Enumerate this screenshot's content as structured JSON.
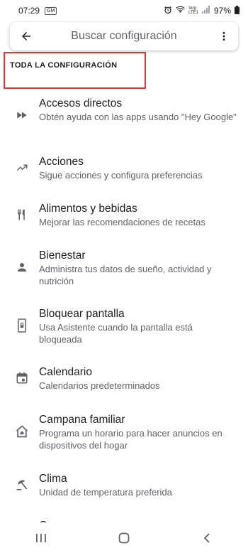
{
  "status_bar": {
    "time": "07:29",
    "badge": "GM",
    "volte_top": "Vo))",
    "volte_bottom": "LTE1",
    "battery": "97%"
  },
  "search": {
    "placeholder": "Buscar configuración"
  },
  "section": {
    "title": "TODA LA CONFIGURACIÓN"
  },
  "items": [
    {
      "title": "Accesos directos",
      "desc": "Obtén ayuda con las apps usando \"Hey Google\"",
      "icon": "fast-forward-icon"
    },
    {
      "title": "Acciones",
      "desc": "Sigue acciones y configura preferencias",
      "icon": "trending-up-icon"
    },
    {
      "title": "Alimentos y bebidas",
      "desc": "Mejorar las recomendaciones de recetas",
      "icon": "restaurant-icon"
    },
    {
      "title": "Bienestar",
      "desc": "Administra tus datos de sueño, actividad y nutrición",
      "icon": "person-icon"
    },
    {
      "title": "Bloquear pantalla",
      "desc": "Usa Asistente cuando la pantalla está bloqueada",
      "icon": "lock-screen-icon"
    },
    {
      "title": "Calendario",
      "desc": "Calendarios predeterminados",
      "icon": "calendar-icon"
    },
    {
      "title": "Campana familiar",
      "desc": "Programa un horario para hacer anuncios en dispositivos del hogar",
      "icon": "home-bell-icon"
    },
    {
      "title": "Clima",
      "desc": "Unidad de temperatura preferida",
      "icon": "beach-umbrella-icon"
    },
    {
      "title": "Compras",
      "desc": "",
      "icon": "shopping-icon"
    }
  ],
  "colors": {
    "accent_box": "#d93838",
    "text_primary": "#202124",
    "text_secondary": "#5f6368",
    "icon": "#5f6368"
  }
}
